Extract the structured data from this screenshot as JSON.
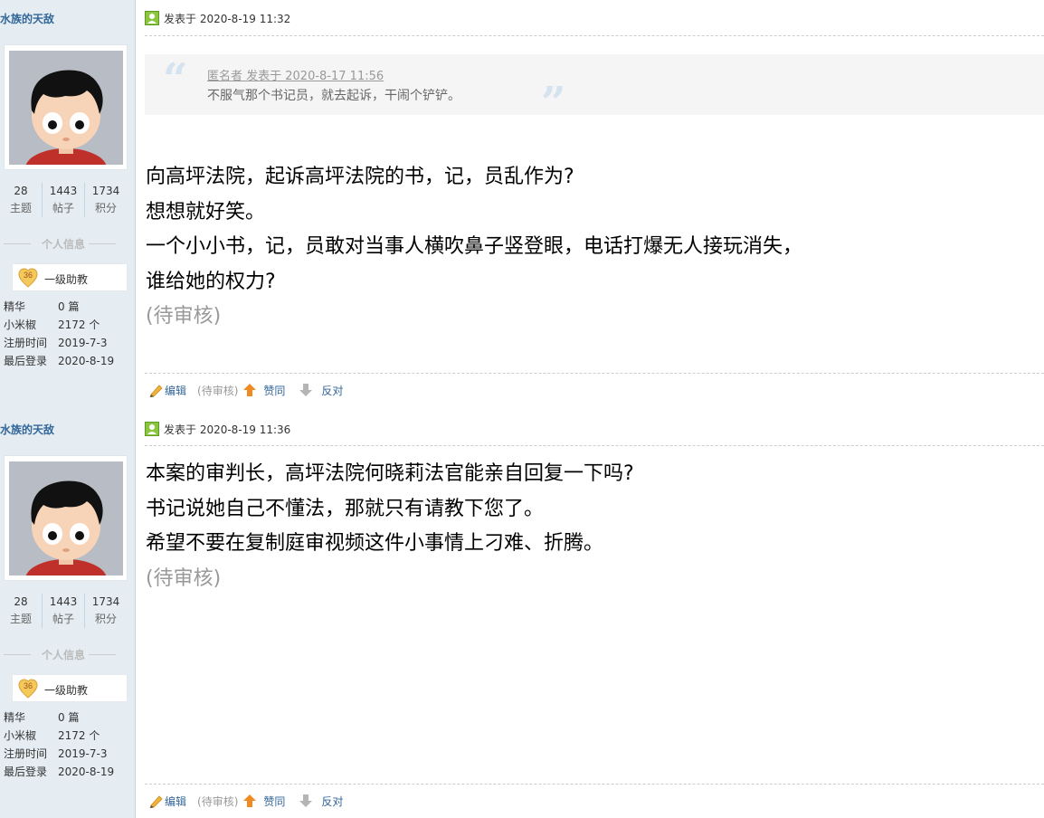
{
  "posts": [
    {
      "author": "水族的天敌",
      "stats": [
        {
          "num": "28",
          "label": "主题"
        },
        {
          "num": "1443",
          "label": "帖子"
        },
        {
          "num": "1734",
          "label": "积分"
        }
      ],
      "section_title": "个人信息",
      "rank_level": "36",
      "rank_title": "一级助教",
      "info": [
        {
          "k": "精华",
          "v": "0 篇"
        },
        {
          "k": "小米椒",
          "v": "2172 个"
        },
        {
          "k": "注册时间",
          "v": "2019-7-3"
        },
        {
          "k": "最后登录",
          "v": "2020-8-19"
        }
      ],
      "posted_at": "发表于 2020-8-19 11:32",
      "quote": {
        "meta": "匿名者 发表于 2020-8-17 11:56",
        "text": "不服气那个书记员，就去起诉，干闹个铲铲。"
      },
      "body_lines": [
        "向高坪法院，起诉高坪法院的书，记，员乱作为?",
        "想想就好笑。",
        "一个小小书，记，员敢对当事人横吹鼻子竖登眼，电话打爆无人接玩消失，",
        "谁给她的权力?"
      ],
      "pending": "(待审核)",
      "actions": {
        "edit": "编辑",
        "pending": "(待审核)",
        "upvote": "赞同",
        "downvote": "反对"
      }
    },
    {
      "author": "水族的天敌",
      "stats": [
        {
          "num": "28",
          "label": "主题"
        },
        {
          "num": "1443",
          "label": "帖子"
        },
        {
          "num": "1734",
          "label": "积分"
        }
      ],
      "section_title": "个人信息",
      "rank_level": "36",
      "rank_title": "一级助教",
      "info": [
        {
          "k": "精华",
          "v": "0 篇"
        },
        {
          "k": "小米椒",
          "v": "2172 个"
        },
        {
          "k": "注册时间",
          "v": "2019-7-3"
        },
        {
          "k": "最后登录",
          "v": "2020-8-19"
        }
      ],
      "posted_at": "发表于 2020-8-19 11:36",
      "body_lines": [
        "本案的审判长，高坪法院何晓莉法官能亲自回复一下吗?",
        "书记说她自己不懂法，那就只有请教下您了。",
        "希望不要在复制庭审视频这件小事情上刁难、折腾。"
      ],
      "pending": "(待审核)",
      "actions": {
        "edit": "编辑",
        "pending": "(待审核)",
        "upvote": "赞同",
        "downvote": "反对"
      }
    }
  ]
}
